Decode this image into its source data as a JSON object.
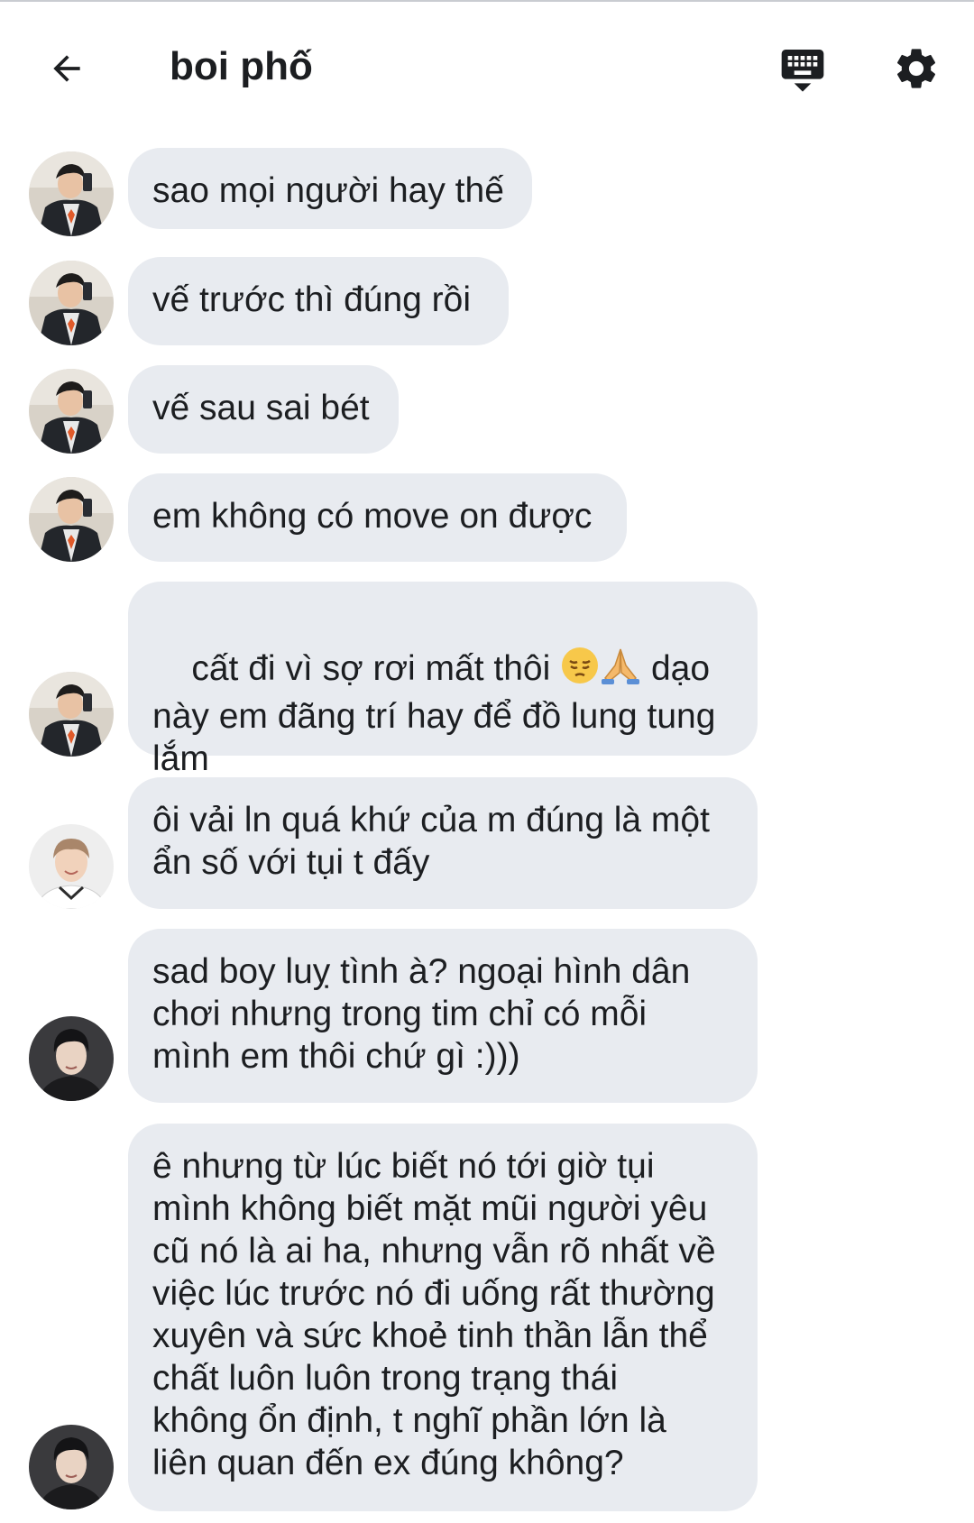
{
  "header": {
    "title": "boi phố",
    "back_icon": "arrow-left-icon",
    "keyboard_icon": "keyboard-icon",
    "settings_icon": "gear-icon"
  },
  "colors": {
    "bubble": "#e8ebf0",
    "text": "#1c1e21",
    "background": "#ffffff"
  },
  "messages": [
    {
      "sender": "user-a",
      "text": "sao mọi người hay thế"
    },
    {
      "sender": "user-a",
      "text": "vế trước thì đúng rồi"
    },
    {
      "sender": "user-a",
      "text": "vế sau sai bét"
    },
    {
      "sender": "user-a",
      "text": "em không có move on được"
    },
    {
      "sender": "user-a",
      "text_before": "cất đi vì sợ rơi mất thôi ",
      "emoji": [
        "pensive-face-icon",
        "folded-hands-icon"
      ],
      "text_after": " dạo\nnày em đãng trí hay để đồ lung tung\nlắm"
    },
    {
      "sender": "user-b",
      "text": "ôi vải ln quá khứ của m đúng là một\nẩn số với tụi t đấy"
    },
    {
      "sender": "user-c",
      "text": "sad boy luỵ tình à? ngoại hình dân\nchơi nhưng trong tim chỉ có mỗi\nmình em thôi chứ gì :)))"
    },
    {
      "sender": "user-c",
      "text": "ê nhưng từ lúc biết nó tới giờ tụi\nmình không biết mặt mũi người yêu\ncũ nó là ai ha, nhưng vẫn rõ nhất về\nviệc lúc trước nó đi uống rất thường\nxuyên và sức khoẻ tinh thần lẫn thể\nchất luôn luôn trong trạng thái\nkhông ổn định, t nghĩ phần lớn là\nliên quan đến ex đúng không?"
    }
  ]
}
